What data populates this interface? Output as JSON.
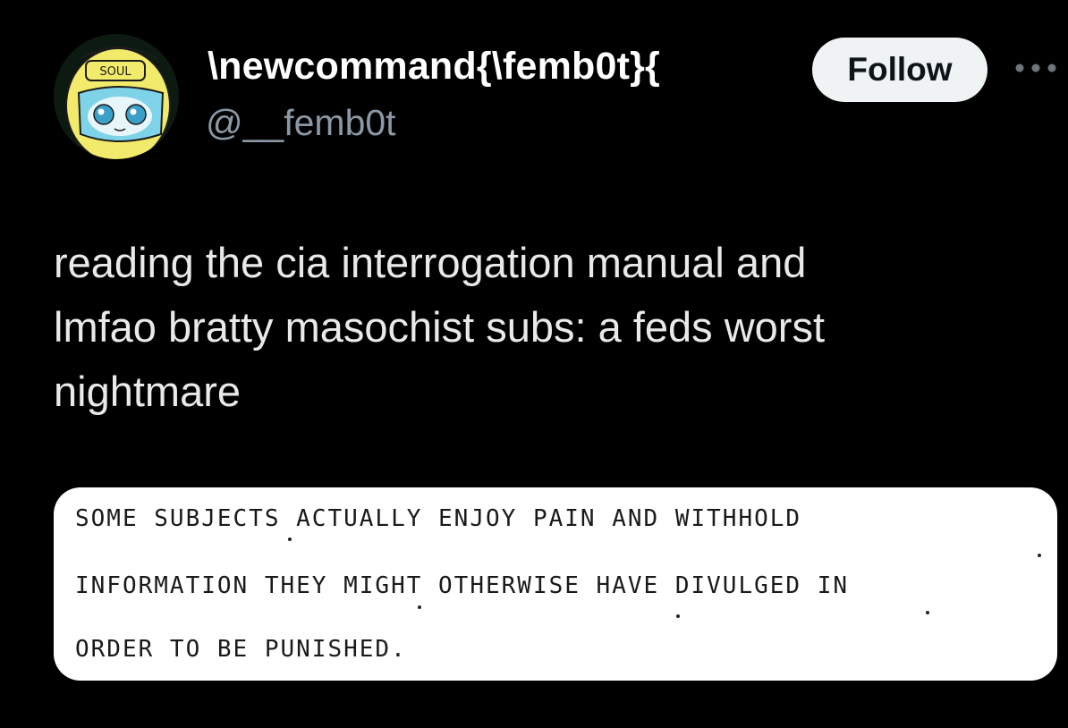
{
  "user": {
    "display_name": "\\newcommand{\\femb0t}{",
    "handle": "@__femb0t",
    "avatar_badge_text": "SOUL"
  },
  "actions": {
    "follow_label": "Follow",
    "more_icon": "more-horizontal-icon"
  },
  "tweet": {
    "lines": [
      "reading the cia interrogation manual and",
      "lmfao bratty masochist subs: a feds worst",
      "nightmare"
    ]
  },
  "media": {
    "lines": [
      "SOME SUBJECTS ACTUALLY ENJOY PAIN AND WITHHOLD",
      "INFORMATION THEY MIGHT OTHERWISE HAVE DIVULGED IN",
      "ORDER TO BE PUNISHED."
    ]
  },
  "colors": {
    "background": "#000000",
    "primary_text": "#e7e9ea",
    "secondary_text": "#8b98a5",
    "follow_bg": "#eff3f4",
    "avatar_yellow": "#f2ea6a"
  }
}
